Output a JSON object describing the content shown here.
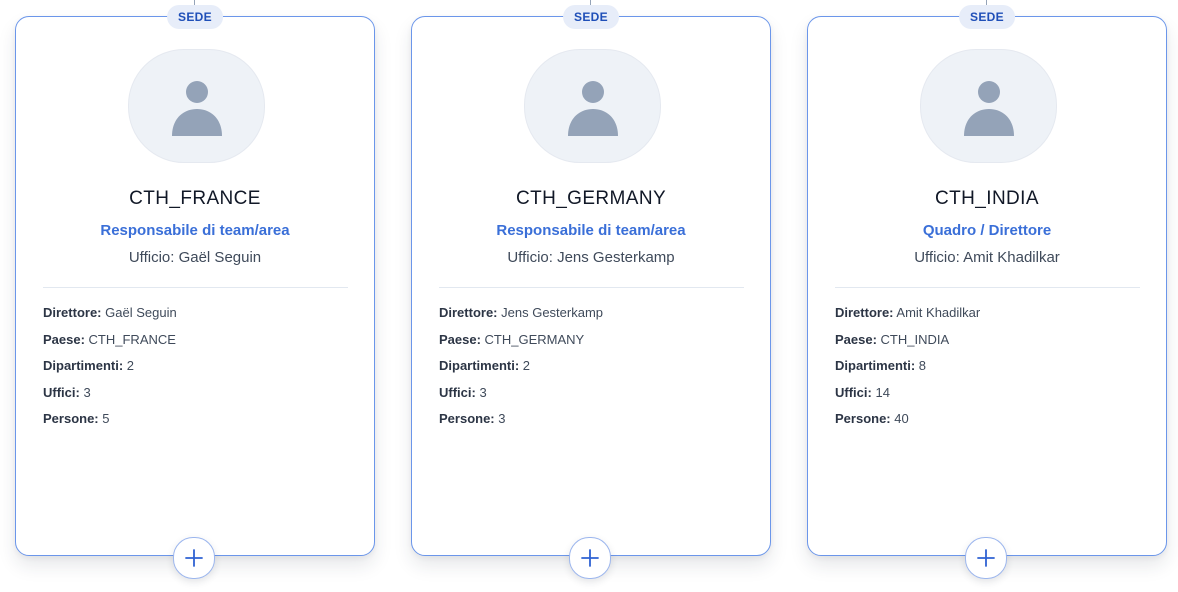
{
  "colors": {
    "card_border": "#6b96ea",
    "accent": "#3a6fd8",
    "badge_bg": "#e7edf9",
    "badge_text": "#1f4fb8",
    "avatar_bg": "#eef2f7",
    "avatar_icon": "#94a3b8"
  },
  "icons": {
    "avatar": "user-silhouette-icon",
    "add": "plus-icon"
  },
  "cards": [
    {
      "badge": "SEDE",
      "name": "CTH_FRANCE",
      "role": "Responsabile di team/area",
      "office": "Ufficio: Gaël Seguin",
      "details": [
        {
          "label": "Direttore:",
          "value": "Gaël Seguin"
        },
        {
          "label": "Paese:",
          "value": "CTH_FRANCE"
        },
        {
          "label": "Dipartimenti:",
          "value": "2"
        },
        {
          "label": "Uffici:",
          "value": "3"
        },
        {
          "label": "Persone:",
          "value": "5"
        }
      ]
    },
    {
      "badge": "SEDE",
      "name": "CTH_GERMANY",
      "role": "Responsabile di team/area",
      "office": "Ufficio: Jens Gesterkamp",
      "details": [
        {
          "label": "Direttore:",
          "value": "Jens Gesterkamp"
        },
        {
          "label": "Paese:",
          "value": "CTH_GERMANY"
        },
        {
          "label": "Dipartimenti:",
          "value": "2"
        },
        {
          "label": "Uffici:",
          "value": "3"
        },
        {
          "label": "Persone:",
          "value": "3"
        }
      ]
    },
    {
      "badge": "SEDE",
      "name": "CTH_INDIA",
      "role": "Quadro / Direttore",
      "office": "Ufficio: Amit Khadilkar",
      "details": [
        {
          "label": "Direttore:",
          "value": "Amit Khadilkar"
        },
        {
          "label": "Paese:",
          "value": "CTH_INDIA"
        },
        {
          "label": "Dipartimenti:",
          "value": "8"
        },
        {
          "label": "Uffici:",
          "value": "14"
        },
        {
          "label": "Persone:",
          "value": "40"
        }
      ]
    }
  ]
}
